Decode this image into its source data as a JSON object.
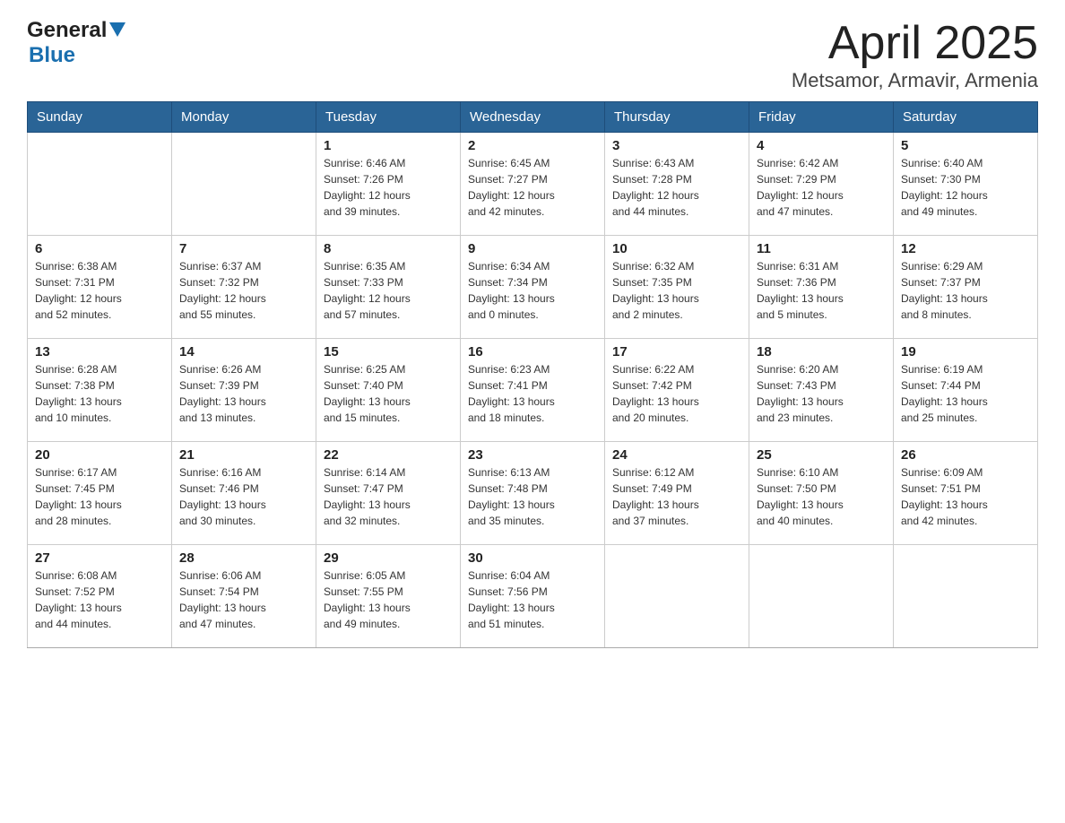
{
  "header": {
    "logo": {
      "general": "General",
      "blue": "Blue"
    },
    "title": "April 2025",
    "subtitle": "Metsamor, Armavir, Armenia"
  },
  "calendar": {
    "days": [
      "Sunday",
      "Monday",
      "Tuesday",
      "Wednesday",
      "Thursday",
      "Friday",
      "Saturday"
    ],
    "weeks": [
      [
        {
          "day": "",
          "info": ""
        },
        {
          "day": "",
          "info": ""
        },
        {
          "day": "1",
          "info": "Sunrise: 6:46 AM\nSunset: 7:26 PM\nDaylight: 12 hours\nand 39 minutes."
        },
        {
          "day": "2",
          "info": "Sunrise: 6:45 AM\nSunset: 7:27 PM\nDaylight: 12 hours\nand 42 minutes."
        },
        {
          "day": "3",
          "info": "Sunrise: 6:43 AM\nSunset: 7:28 PM\nDaylight: 12 hours\nand 44 minutes."
        },
        {
          "day": "4",
          "info": "Sunrise: 6:42 AM\nSunset: 7:29 PM\nDaylight: 12 hours\nand 47 minutes."
        },
        {
          "day": "5",
          "info": "Sunrise: 6:40 AM\nSunset: 7:30 PM\nDaylight: 12 hours\nand 49 minutes."
        }
      ],
      [
        {
          "day": "6",
          "info": "Sunrise: 6:38 AM\nSunset: 7:31 PM\nDaylight: 12 hours\nand 52 minutes."
        },
        {
          "day": "7",
          "info": "Sunrise: 6:37 AM\nSunset: 7:32 PM\nDaylight: 12 hours\nand 55 minutes."
        },
        {
          "day": "8",
          "info": "Sunrise: 6:35 AM\nSunset: 7:33 PM\nDaylight: 12 hours\nand 57 minutes."
        },
        {
          "day": "9",
          "info": "Sunrise: 6:34 AM\nSunset: 7:34 PM\nDaylight: 13 hours\nand 0 minutes."
        },
        {
          "day": "10",
          "info": "Sunrise: 6:32 AM\nSunset: 7:35 PM\nDaylight: 13 hours\nand 2 minutes."
        },
        {
          "day": "11",
          "info": "Sunrise: 6:31 AM\nSunset: 7:36 PM\nDaylight: 13 hours\nand 5 minutes."
        },
        {
          "day": "12",
          "info": "Sunrise: 6:29 AM\nSunset: 7:37 PM\nDaylight: 13 hours\nand 8 minutes."
        }
      ],
      [
        {
          "day": "13",
          "info": "Sunrise: 6:28 AM\nSunset: 7:38 PM\nDaylight: 13 hours\nand 10 minutes."
        },
        {
          "day": "14",
          "info": "Sunrise: 6:26 AM\nSunset: 7:39 PM\nDaylight: 13 hours\nand 13 minutes."
        },
        {
          "day": "15",
          "info": "Sunrise: 6:25 AM\nSunset: 7:40 PM\nDaylight: 13 hours\nand 15 minutes."
        },
        {
          "day": "16",
          "info": "Sunrise: 6:23 AM\nSunset: 7:41 PM\nDaylight: 13 hours\nand 18 minutes."
        },
        {
          "day": "17",
          "info": "Sunrise: 6:22 AM\nSunset: 7:42 PM\nDaylight: 13 hours\nand 20 minutes."
        },
        {
          "day": "18",
          "info": "Sunrise: 6:20 AM\nSunset: 7:43 PM\nDaylight: 13 hours\nand 23 minutes."
        },
        {
          "day": "19",
          "info": "Sunrise: 6:19 AM\nSunset: 7:44 PM\nDaylight: 13 hours\nand 25 minutes."
        }
      ],
      [
        {
          "day": "20",
          "info": "Sunrise: 6:17 AM\nSunset: 7:45 PM\nDaylight: 13 hours\nand 28 minutes."
        },
        {
          "day": "21",
          "info": "Sunrise: 6:16 AM\nSunset: 7:46 PM\nDaylight: 13 hours\nand 30 minutes."
        },
        {
          "day": "22",
          "info": "Sunrise: 6:14 AM\nSunset: 7:47 PM\nDaylight: 13 hours\nand 32 minutes."
        },
        {
          "day": "23",
          "info": "Sunrise: 6:13 AM\nSunset: 7:48 PM\nDaylight: 13 hours\nand 35 minutes."
        },
        {
          "day": "24",
          "info": "Sunrise: 6:12 AM\nSunset: 7:49 PM\nDaylight: 13 hours\nand 37 minutes."
        },
        {
          "day": "25",
          "info": "Sunrise: 6:10 AM\nSunset: 7:50 PM\nDaylight: 13 hours\nand 40 minutes."
        },
        {
          "day": "26",
          "info": "Sunrise: 6:09 AM\nSunset: 7:51 PM\nDaylight: 13 hours\nand 42 minutes."
        }
      ],
      [
        {
          "day": "27",
          "info": "Sunrise: 6:08 AM\nSunset: 7:52 PM\nDaylight: 13 hours\nand 44 minutes."
        },
        {
          "day": "28",
          "info": "Sunrise: 6:06 AM\nSunset: 7:54 PM\nDaylight: 13 hours\nand 47 minutes."
        },
        {
          "day": "29",
          "info": "Sunrise: 6:05 AM\nSunset: 7:55 PM\nDaylight: 13 hours\nand 49 minutes."
        },
        {
          "day": "30",
          "info": "Sunrise: 6:04 AM\nSunset: 7:56 PM\nDaylight: 13 hours\nand 51 minutes."
        },
        {
          "day": "",
          "info": ""
        },
        {
          "day": "",
          "info": ""
        },
        {
          "day": "",
          "info": ""
        }
      ]
    ]
  }
}
